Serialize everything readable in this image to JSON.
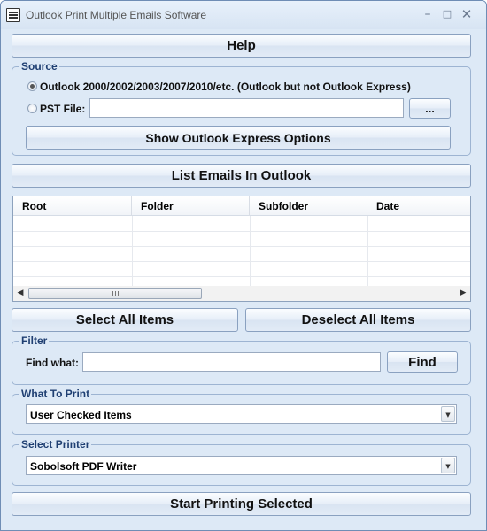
{
  "window": {
    "title": "Outlook Print Multiple Emails Software"
  },
  "buttons": {
    "help": "Help",
    "browse": "...",
    "show_oe_options": "Show Outlook Express Options",
    "list_emails": "List Emails In Outlook",
    "select_all": "Select All Items",
    "deselect_all": "Deselect All Items",
    "find": "Find",
    "start_printing": "Start Printing Selected"
  },
  "source": {
    "label": "Source",
    "option_outlook": "Outlook 2000/2002/2003/2007/2010/etc. (Outlook but not Outlook Express)",
    "option_pst": "PST File:",
    "pst_value": "",
    "selected": "outlook"
  },
  "list": {
    "columns": [
      "Root",
      "Folder",
      "Subfolder",
      "Date"
    ],
    "rows": []
  },
  "filter": {
    "label": "Filter",
    "find_what_label": "Find what:",
    "find_value": ""
  },
  "what_to_print": {
    "label": "What To Print",
    "selected": "User Checked Items"
  },
  "select_printer": {
    "label": "Select Printer",
    "selected": "Sobolsoft PDF Writer"
  }
}
